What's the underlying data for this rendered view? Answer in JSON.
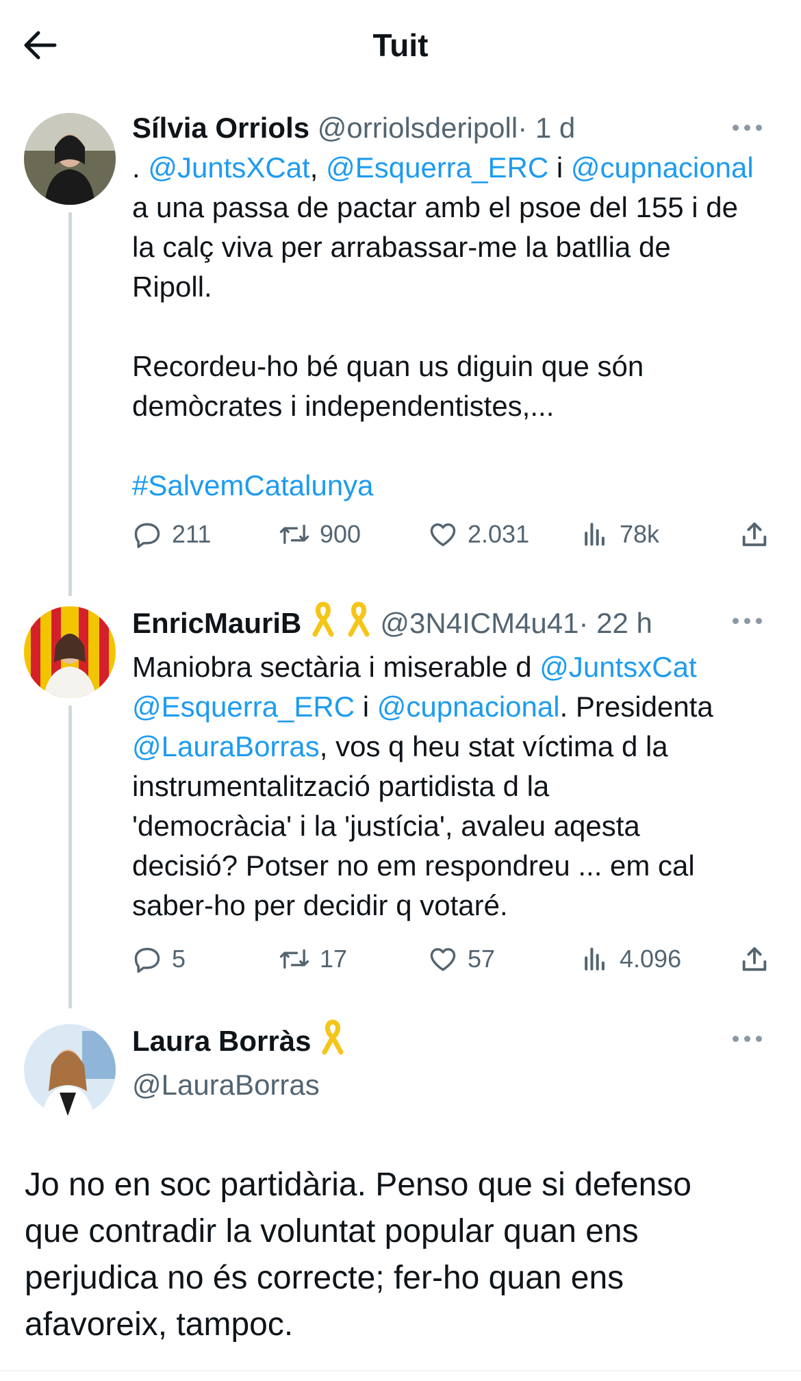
{
  "header": {
    "title": "Tuit"
  },
  "tweets": [
    {
      "name": "Sílvia Orriols",
      "handle": "@orriolsderipoll",
      "time": "· 1 d",
      "body": {
        "prefix": ". ",
        "m1": "@JuntsXCat",
        "sep1": ", ",
        "m2": "@Esquerra_ERC",
        "sep2": " i ",
        "m3": "@cupnacional",
        "line2": "a una passa de pactar amb el psoe del 155 i de",
        "line3": "la calç viva per arrabassar-me la batllia de",
        "line4": "Ripoll.",
        "para2_line1": "Recordeu-ho bé quan us diguin que són",
        "para2_line2": "demòcrates i independentistes,...",
        "hashtag": "#SalvemCatalunya"
      },
      "stats": {
        "replies": "211",
        "retweets": "900",
        "likes": "2.031",
        "views": "78k"
      }
    },
    {
      "name": "EnricMauriB",
      "handle": "@3N4ICM4u41",
      "time": "· 22 h",
      "body": {
        "l1_text": "Maniobra sectària i miserable d ",
        "l1_link": "@JuntsxCat",
        "l2_link1": "@Esquerra_ERC",
        "l2_mid": " i ",
        "l2_link2": "@cupnacional",
        "l2_end": ". Presidenta",
        "l3_link": "@LauraBorras",
        "l3_end": ", vos q heu stat víctima d la",
        "l4": "instrumentalització partidista d la",
        "l5": "'democràcia' i la 'justícia', avaleu aqesta",
        "l6": "decisió? Potser no em respondreu ... em cal",
        "l7": "saber-ho per decidir q votaré."
      },
      "stats": {
        "replies": "5",
        "retweets": "17",
        "likes": "57",
        "views": "4.096"
      }
    },
    {
      "name": "Laura Borràs",
      "handle": "@LauraBorras",
      "text_lines": [
        "Jo no en soc partidària. Penso que si defenso",
        "que contradir la voluntat popular quan ens",
        "perjudica no és correcte; fer-ho quan ens",
        "afavoreix, tampoc."
      ]
    }
  ],
  "colors": {
    "link": "#1d9bf0",
    "muted": "#536471",
    "ribbon": "#f5c518"
  },
  "icons": [
    "back-arrow-icon",
    "more-icon",
    "reply-icon",
    "retweet-icon",
    "like-icon",
    "views-icon",
    "share-icon",
    "yellow-ribbon-icon"
  ]
}
